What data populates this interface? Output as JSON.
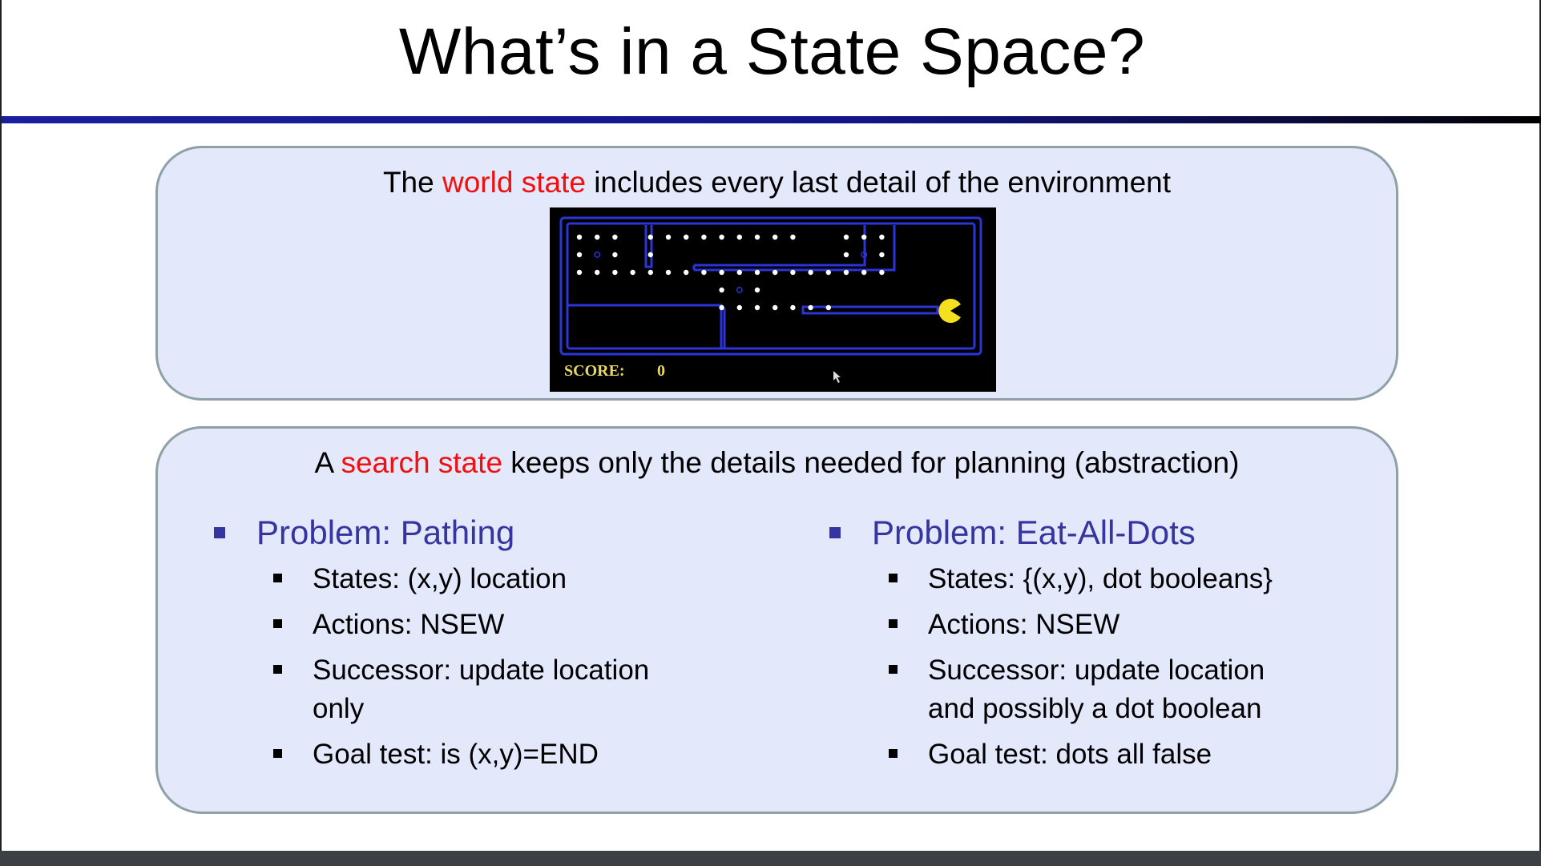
{
  "slide": {
    "title": "What’s in a State Space?"
  },
  "world_panel": {
    "caption_before": "The ",
    "caption_highlight": "world state",
    "caption_after": " includes every last detail of the environment",
    "game": {
      "score_label": "SCORE:",
      "score_value": "0"
    }
  },
  "search_panel": {
    "caption_before": "A ",
    "caption_highlight": "search state",
    "caption_after": " keeps only the details needed for planning (abstraction)",
    "left": {
      "heading": "Problem: Pathing",
      "items": [
        "States: (x,y) location",
        "Actions: NSEW",
        "Successor: update location only",
        "Goal test: is (x,y)=END"
      ]
    },
    "right": {
      "heading": "Problem: Eat-All-Dots",
      "items": [
        "States: {(x,y), dot booleans}",
        "Actions: NSEW",
        "Successor: update location and possibly a dot boolean",
        "Goal test: dots all false"
      ]
    }
  },
  "colors": {
    "highlight": "#f01010",
    "heading": "#3535a0",
    "panel_bg": "#e3e8fb",
    "maze_wall": "#2b34d6",
    "pacman": "#f5e020",
    "score_text": "#e8d860"
  }
}
